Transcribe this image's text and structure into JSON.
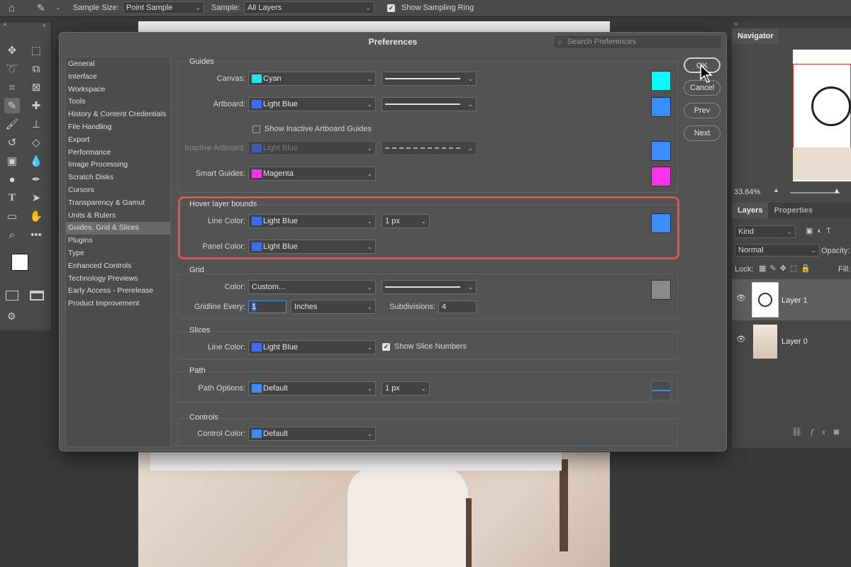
{
  "optbar": {
    "sample_size_label": "Sample Size:",
    "sample_size": "Point Sample",
    "sample_label": "Sample:",
    "sample": "All Layers",
    "sampling_ring": "Show Sampling Ring"
  },
  "dialog": {
    "title": "Preferences",
    "search_placeholder": "Search Preferences",
    "nav": [
      "General",
      "Interface",
      "Workspace",
      "Tools",
      "History & Content Credentials",
      "File Handling",
      "Export",
      "Performance",
      "Image Processing",
      "Scratch Disks",
      "Cursors",
      "Transparency & Gamut",
      "Units & Rulers",
      "Guides, Grid & Slices",
      "Plugins",
      "Type",
      "Enhanced Controls",
      "Technology Previews",
      "Early Access - Prerelease",
      "Product Improvement"
    ],
    "buttons": {
      "ok": "OK",
      "cancel": "Cancel",
      "prev": "Prev",
      "next": "Next"
    },
    "guides": {
      "title": "Guides",
      "canvas_label": "Canvas:",
      "canvas": "Cyan",
      "artboard_label": "Artboard:",
      "artboard": "Light Blue",
      "show_inactive": "Show Inactive Artboard Guides",
      "inactive_label": "Inactive Artboard:",
      "inactive": "Light Blue",
      "smart_label": "Smart Guides:",
      "smart": "Magenta"
    },
    "hover": {
      "title": "Hover layer bounds",
      "line_label": "Line Color:",
      "line": "Light Blue",
      "line_width": "1 px",
      "panel_label": "Panel Color:",
      "panel": "Light Blue"
    },
    "grid": {
      "title": "Grid",
      "color_label": "Color:",
      "color": "Custom...",
      "every_label": "Gridline Every:",
      "every": "1",
      "units": "Inches",
      "subdiv_label": "Subdivisions:",
      "subdiv": "4"
    },
    "slices": {
      "title": "Slices",
      "line_label": "Line Color:",
      "line": "Light Blue",
      "show_numbers": "Show Slice Numbers"
    },
    "path": {
      "title": "Path",
      "options_label": "Path Options:",
      "options": "Default",
      "width": "1 px"
    },
    "controls": {
      "title": "Controls",
      "color_label": "Control Color:",
      "color": "Default"
    }
  },
  "panels": {
    "navigator": "Navigator",
    "zoom": "33.64%",
    "layers_tab": "Layers",
    "properties_tab": "Properties",
    "kind": "Kind",
    "blend": "Normal",
    "opacity_label": "Opacity:",
    "lock_label": "Lock:",
    "fill_label": "Fill:",
    "layers": [
      "Layer 1",
      "Layer 0"
    ]
  },
  "colors": {
    "cyan": "#00ffff",
    "light_blue": "#3a8cff",
    "magenta": "#ff33ee",
    "gray": "#8a8a8a",
    "highlight": "#e8514a"
  }
}
